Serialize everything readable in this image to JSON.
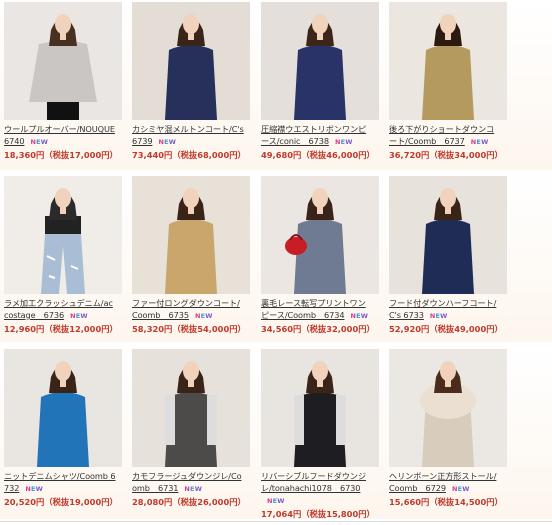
{
  "products": [
    {
      "title": "ウールプルオーバー/NOUQUE 6740",
      "price": "18,360円（税抜17,000円）",
      "icon": "model-grey-pullover",
      "bg": "#e9e6e3",
      "garment": "#c9c6c3",
      "hair": "#4a3020"
    },
    {
      "title": "カシミヤ混メルトンコート/C's 6739",
      "price": "73,440円（税抜68,000円）",
      "icon": "model-navy-coat",
      "bg": "#e3ddd6",
      "garment": "#27305a",
      "hair": "#3a2418"
    },
    {
      "title": "圧縮襟ウエストリボンワンピース/conic　6738",
      "price": "49,680円（税抜46,000円）",
      "icon": "model-navy-dress",
      "bg": "#e4dfda",
      "garment": "#2a3368",
      "hair": "#3d2618"
    },
    {
      "title": "後ろ下がりショートダウンコート/Coomb　6737",
      "price": "36,720円（税抜34,000円）",
      "icon": "model-khaki-down",
      "bg": "#ebe6df",
      "garment": "#b59a60",
      "hair": "#2a1a10"
    },
    {
      "title": "ラメ加工クラッシュデニム/accostage　6736",
      "price": "12,960円（税抜12,000円）",
      "icon": "model-distressed-denim",
      "bg": "#f0ede9",
      "garment": "#a9bdd4",
      "hair": "#2b2b2b"
    },
    {
      "title": "ファー付ロングダウンコート/Coomb　6735",
      "price": "58,320円（税抜54,000円）",
      "icon": "model-beige-long-down",
      "bg": "#e8e1d8",
      "garment": "#c8a66c",
      "hair": "#3a2418"
    },
    {
      "title": "裏毛レース転写プリントワンピース/Coomb　6734",
      "price": "34,560円（税抜32,000円）",
      "icon": "model-print-dress-red-bag",
      "bg": "#ebe6e2",
      "garment": "#6f7b93",
      "hair": "#3a2418"
    },
    {
      "title": "フード付ダウンハーフコート/C's 6733",
      "price": "52,920円（税抜49,000円）",
      "icon": "model-navy-down",
      "bg": "#e7e2dc",
      "garment": "#1f2c55",
      "hair": "#3a2418"
    },
    {
      "title": "ニットデニムシャツ/Coomb 6732",
      "price": "20,520円（税抜19,000円）",
      "icon": "model-blue-shirt",
      "bg": "#e9e5e0",
      "garment": "#2274b8",
      "hair": "#3a2418"
    },
    {
      "title": "カモフラージュダウンジレ/Coomb　6731",
      "price": "28,080円（税抜26,000円）",
      "icon": "model-camo-vest",
      "bg": "#e6e1db",
      "garment": "#4c4b49",
      "hair": "#3a2418"
    },
    {
      "title": "リバーシブルフードダウンジレ/tonahachi1078　6730",
      "price": "17,064円（税抜15,800円）",
      "icon": "model-black-vest",
      "bg": "#e8e4df",
      "garment": "#1e1e22",
      "hair": "#3a2418"
    },
    {
      "title": "ヘリンボーン正方形ストール/Coomb　6729",
      "price": "15,660円（税抜14,500円）",
      "icon": "model-stole",
      "bg": "#ebe7e2",
      "garment": "#d8ccbd",
      "hair": "#4a2c1c"
    }
  ],
  "badge": {
    "n": "N",
    "e": "E",
    "w": "W"
  }
}
